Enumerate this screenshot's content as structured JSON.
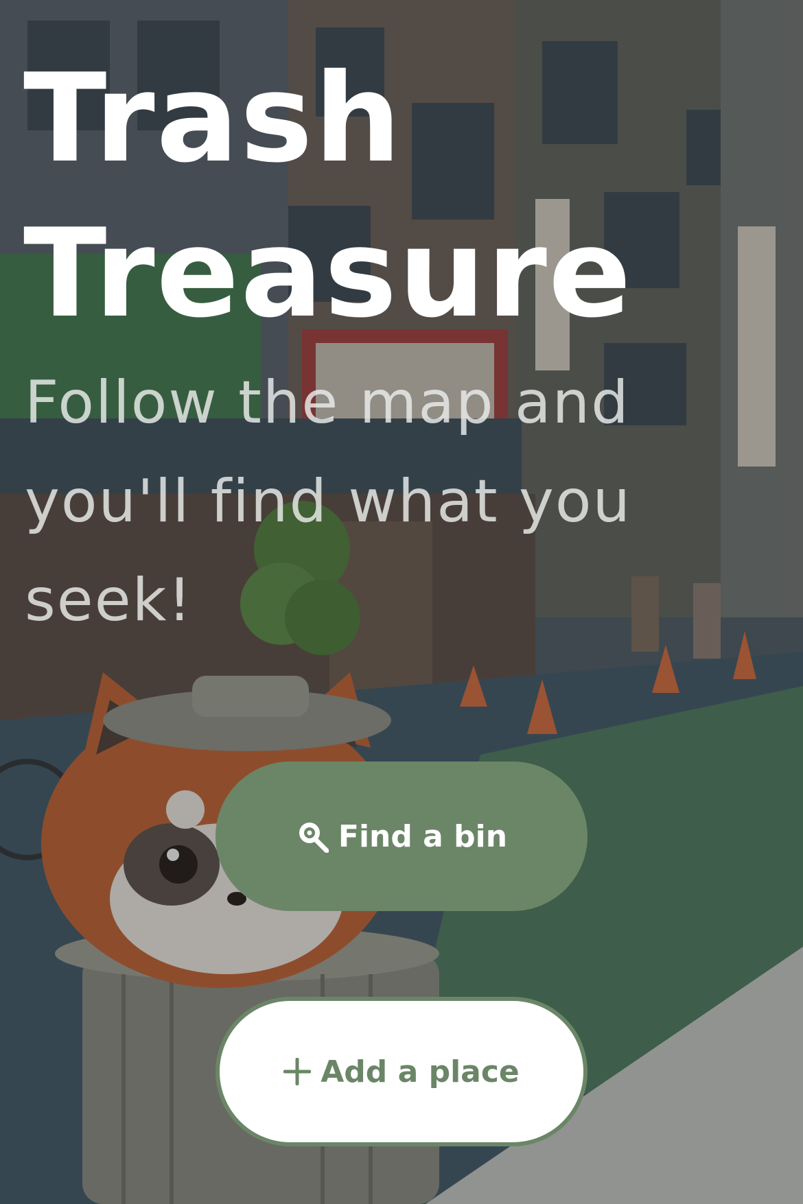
{
  "hero": {
    "title_line1": "Trash",
    "title_line2": "Treasure",
    "subtitle": "Follow the map and you'll find what you seek!"
  },
  "actions": {
    "find_label": "Find a bin",
    "find_icon": "location-search-icon",
    "add_label": "Add a place",
    "add_icon": "plus-icon"
  },
  "colors": {
    "accent": "#6b8667",
    "on_accent": "#ffffff",
    "title_text": "#ffffff"
  }
}
